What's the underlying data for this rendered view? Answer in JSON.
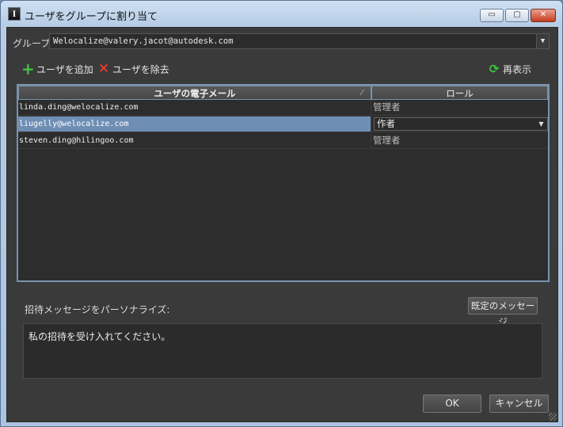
{
  "window": {
    "title": "ユーザをグループに割り当て",
    "controls": {
      "minimize": "▭",
      "maximize": "▢",
      "close": "✕"
    }
  },
  "group": {
    "label": "グループ:",
    "selected_value": "Welocalize@valery.jacot@autodesk.com"
  },
  "toolbar": {
    "add_label": "ユーザを追加",
    "remove_label": "ユーザを除去",
    "refresh_label": "再表示",
    "add_icon": "+",
    "remove_icon": "✕",
    "refresh_icon": "⟳"
  },
  "table": {
    "columns": {
      "email": "ユーザの電子メール",
      "role": "ロール"
    },
    "rows": [
      {
        "email": "linda.ding@welocalize.com",
        "role": "管理者",
        "selected": false
      },
      {
        "email": "liugelly@welocalize.com",
        "role": "作者",
        "selected": true
      },
      {
        "email": "steven.ding@hilingoo.com",
        "role": "管理者",
        "selected": false
      }
    ]
  },
  "invite": {
    "label": "招待メッセージをパーソナライズ:",
    "default_button": "既定のメッセージ",
    "message": "私の招待を受け入れてください。"
  },
  "footer": {
    "ok_label": "OK",
    "cancel_label": "キャンセル"
  },
  "colors": {
    "background": "#3a3a3a",
    "selection": "#6e8eb4",
    "add_icon": "#3ec43e",
    "remove_icon": "#ff3b2f"
  }
}
